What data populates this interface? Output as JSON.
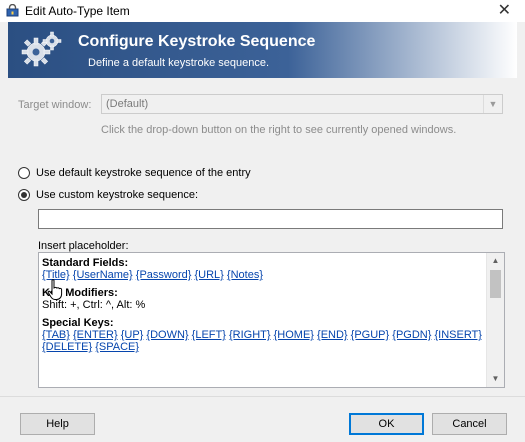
{
  "window": {
    "title": "Edit Auto-Type Item",
    "close_glyph": "✕"
  },
  "banner": {
    "title": "Configure Keystroke Sequence",
    "subtitle": "Define a default keystroke sequence."
  },
  "target_window": {
    "label": "Target window:",
    "value": "(Default)",
    "hint": "Click the drop-down button on the right to see currently opened windows."
  },
  "options": {
    "default_label": "Use default keystroke sequence of the entry",
    "custom_label": "Use custom keystroke sequence:",
    "selected": "custom"
  },
  "sequence_input": {
    "value": ""
  },
  "placeholders": {
    "label": "Insert placeholder:",
    "standard_heading": "Standard Fields:",
    "standard_items": [
      "{Title}",
      "{UserName}",
      "{Password}",
      "{URL}",
      "{Notes}"
    ],
    "modifiers_heading": "Key Modifiers:",
    "modifiers_text": "Shift: +, Ctrl: ^, Alt: %",
    "special_heading": "Special Keys:",
    "special_items": [
      "{TAB}",
      "{ENTER}",
      "{UP}",
      "{DOWN}",
      "{LEFT}",
      "{RIGHT}",
      "{HOME}",
      "{END}",
      "{PGUP}",
      "{PGDN}",
      "{INSERT}",
      "{DELETE}",
      "{SPACE}"
    ]
  },
  "buttons": {
    "help": "Help",
    "ok": "OK",
    "cancel": "Cancel"
  },
  "colors": {
    "banner_start": "#2b4f82",
    "link": "#0645ad",
    "ok_border": "#0078d7"
  }
}
